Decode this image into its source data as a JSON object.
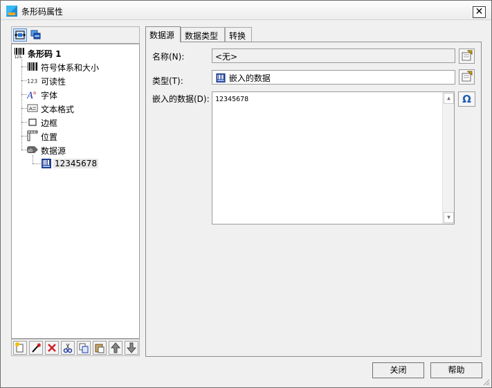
{
  "window": {
    "title": "条形码属性",
    "close_glyph": "✕",
    "icon": "barcode-properties-app-icon"
  },
  "left_toolbar": {
    "buttons": [
      {
        "icon": "fit-size-icon",
        "active": true
      },
      {
        "icon": "layers-icon",
        "active": false
      }
    ]
  },
  "tree": {
    "root": {
      "label": "条形码 1",
      "icon": "barcode-icon"
    },
    "items": [
      {
        "label": "符号体系和大小",
        "icon": "barcode-symbology-icon"
      },
      {
        "label": "可读性",
        "icon": "readability-123-icon"
      },
      {
        "label": "字体",
        "icon": "font-icon"
      },
      {
        "label": "文本格式",
        "icon": "text-format-icon"
      },
      {
        "label": "边框",
        "icon": "border-icon"
      },
      {
        "label": "位置",
        "icon": "position-ruler-icon"
      },
      {
        "label": "数据源",
        "icon": "data-source-icon"
      }
    ],
    "child": {
      "label": "12345678",
      "icon": "embedded-data-icon"
    }
  },
  "left_bottom_toolbar": {
    "buttons": [
      {
        "icon": "new-item-icon"
      },
      {
        "icon": "wizard-icon"
      },
      {
        "icon": "delete-icon"
      },
      {
        "icon": "cut-icon"
      },
      {
        "icon": "copy-icon"
      },
      {
        "icon": "paste-icon"
      },
      {
        "icon": "move-up-icon"
      },
      {
        "icon": "move-down-icon"
      }
    ]
  },
  "tabs": [
    {
      "label": "数据源",
      "active": true
    },
    {
      "label": "数据类型",
      "active": false
    },
    {
      "label": "转换",
      "active": false
    }
  ],
  "form": {
    "name_label": "名称(N):",
    "name_value": "<无>",
    "type_label": "类型(T):",
    "type_value": "嵌入的数据",
    "data_label": "嵌入的数据(D):",
    "data_value": "12345678",
    "omega_glyph": "Ω"
  },
  "footer": {
    "close_label": "关闭",
    "help_label": "帮助"
  },
  "colors": {
    "accent": "#1e5fb5",
    "selection": "#cfe3fb"
  }
}
